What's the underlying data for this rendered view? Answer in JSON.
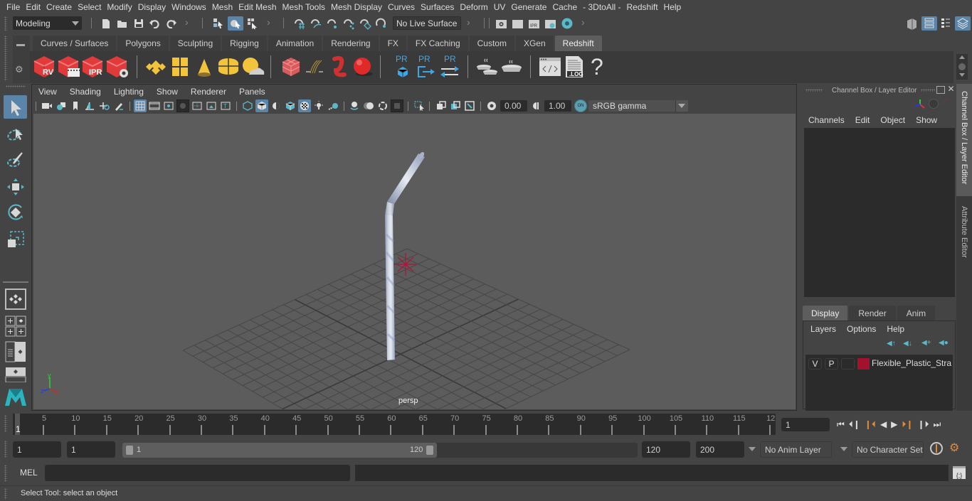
{
  "menubar": {
    "items": [
      "File",
      "Edit",
      "Create",
      "Select",
      "Modify",
      "Display",
      "Windows",
      "Mesh",
      "Edit Mesh",
      "Mesh Tools",
      "Mesh Display",
      "Curves",
      "Surfaces",
      "Deform",
      "UV",
      "Generate",
      "Cache",
      "- 3DtoAll -",
      "Redshift",
      "Help"
    ]
  },
  "statusline": {
    "workspace_menu": "Modeling",
    "live_surface": "No Live Surface",
    "icons": [
      "new-scene-icon",
      "open-scene-icon",
      "save-scene-icon",
      "undo-icon",
      "redo-icon",
      "select-by-hierarchy-icon",
      "select-by-object-icon",
      "select-by-component-icon",
      "snap-grid-icon",
      "snap-curve-icon",
      "snap-point-icon",
      "snap-view-plane-icon",
      "snap-surface-icon",
      "make-live-icon",
      "render-view-icon",
      "render-frame-icon",
      "ipr-render-icon",
      "render-settings-icon",
      "hypershade-icon"
    ],
    "right_icons": [
      "modeling-toolkit-icon",
      "attribute-editor-toggle-icon",
      "tool-settings-toggle-icon",
      "channel-box-toggle-icon"
    ]
  },
  "shelf": {
    "tabs": [
      "Curves / Surfaces",
      "Polygons",
      "Sculpting",
      "Rigging",
      "Animation",
      "Rendering",
      "FX",
      "FX Caching",
      "Custom",
      "XGen",
      "Redshift"
    ],
    "active_tab": "Redshift",
    "rv_label": "RV",
    "ipr_label": "IPR",
    "pr_label": "PR",
    "log_label": ".LOG",
    "help_label": "?"
  },
  "viewport": {
    "menu": [
      "View",
      "Shading",
      "Lighting",
      "Show",
      "Renderer",
      "Panels"
    ],
    "exposure": "0.00",
    "gamma": "1.00",
    "colorspace_toggle": "ON",
    "colorspace": "sRGB gamma",
    "camera_label": "persp",
    "axis_labels": {
      "x": "x",
      "y": "y",
      "z": "z"
    },
    "object_name": "Flexible_Plastic_Straw"
  },
  "channel_box": {
    "title": "Channel Box / Layer Editor",
    "menu": [
      "Channels",
      "Edit",
      "Object",
      "Show"
    ]
  },
  "layer_editor": {
    "tabs": [
      "Display",
      "Render",
      "Anim"
    ],
    "active_tab": "Display",
    "menu": [
      "Layers",
      "Options",
      "Help"
    ],
    "layers": [
      {
        "visible": "V",
        "playback": "P",
        "color": "#a3112f",
        "name": "Flexible_Plastic_Straw_"
      }
    ]
  },
  "side_tabs": [
    "Channel Box / Layer Editor",
    "Attribute Editor"
  ],
  "timeline": {
    "start_label": "1",
    "ticks": [
      "5",
      "10",
      "15",
      "20",
      "25",
      "30",
      "35",
      "40",
      "45",
      "50",
      "55",
      "60",
      "65",
      "70",
      "75",
      "80",
      "85",
      "90",
      "95",
      "100",
      "105",
      "110",
      "115",
      "12"
    ],
    "current_frame": "1"
  },
  "range": {
    "scene_start": "1",
    "playback_start": "1",
    "range_start_label": "1",
    "range_end_label": "120",
    "playback_end": "120",
    "scene_end": "200",
    "anim_layer": "No Anim Layer",
    "character_set": "No Character Set"
  },
  "command": {
    "language": "MEL",
    "input": "",
    "output": ""
  },
  "help_line": "Select Tool: select an object"
}
